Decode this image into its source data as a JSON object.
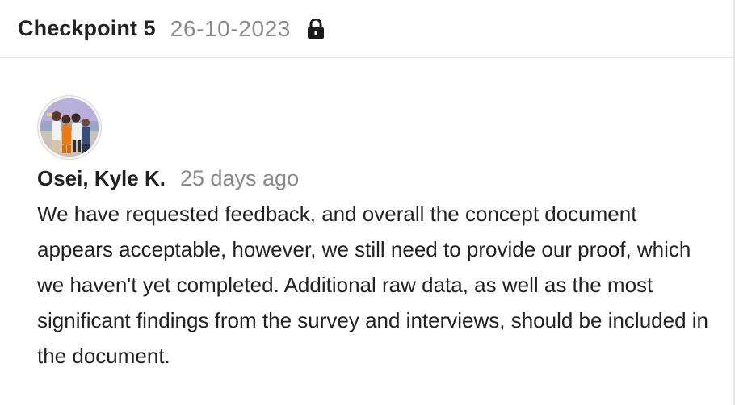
{
  "header": {
    "title": "Checkpoint 5",
    "date": "26-10-2023",
    "lock_icon": "lock-icon"
  },
  "comment": {
    "avatar_icon": "avatar",
    "author": "Osei, Kyle K.",
    "time_ago": "25 days ago",
    "text": "We have requested feedback, and overall the concept document appears acceptable, however, we still need to provide our proof, which we haven't yet completed. Additional raw data, as well as the most significant findings from the survey and interviews, should be included in the document."
  },
  "colors": {
    "title": "#222222",
    "muted": "#8a8a8a",
    "divider": "#e5e5e5"
  }
}
